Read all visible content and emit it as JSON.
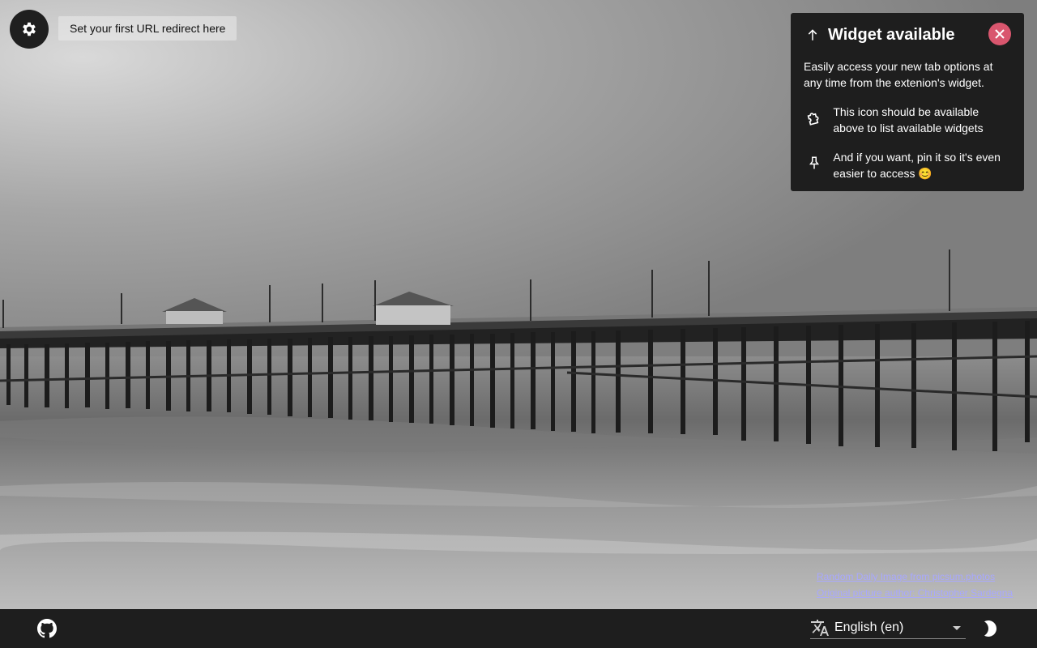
{
  "toolbar": {
    "redirect_hint": "Set your first URL redirect here"
  },
  "popup": {
    "title": "Widget available",
    "description": "Easily access your new tab options at any time from the extenion's widget.",
    "rows": [
      {
        "icon": "puzzle-icon",
        "text": "This icon should be available above to list available widgets"
      },
      {
        "icon": "pin-icon",
        "text": "And if you want, pin it so it's even easier to access 😊"
      }
    ],
    "colors": {
      "background": "#1e1e1e",
      "close": "#d9566e"
    }
  },
  "credits": {
    "line1": "Random Daily Image from picsum.photos",
    "line2": "Original picture author: Christopher Sardegna"
  },
  "footer": {
    "language": "English (en)"
  },
  "icons": [
    "settings-icon",
    "arrow-up-icon",
    "close-icon",
    "puzzle-icon",
    "pin-icon",
    "github-icon",
    "translate-icon",
    "dark-mode-icon"
  ]
}
